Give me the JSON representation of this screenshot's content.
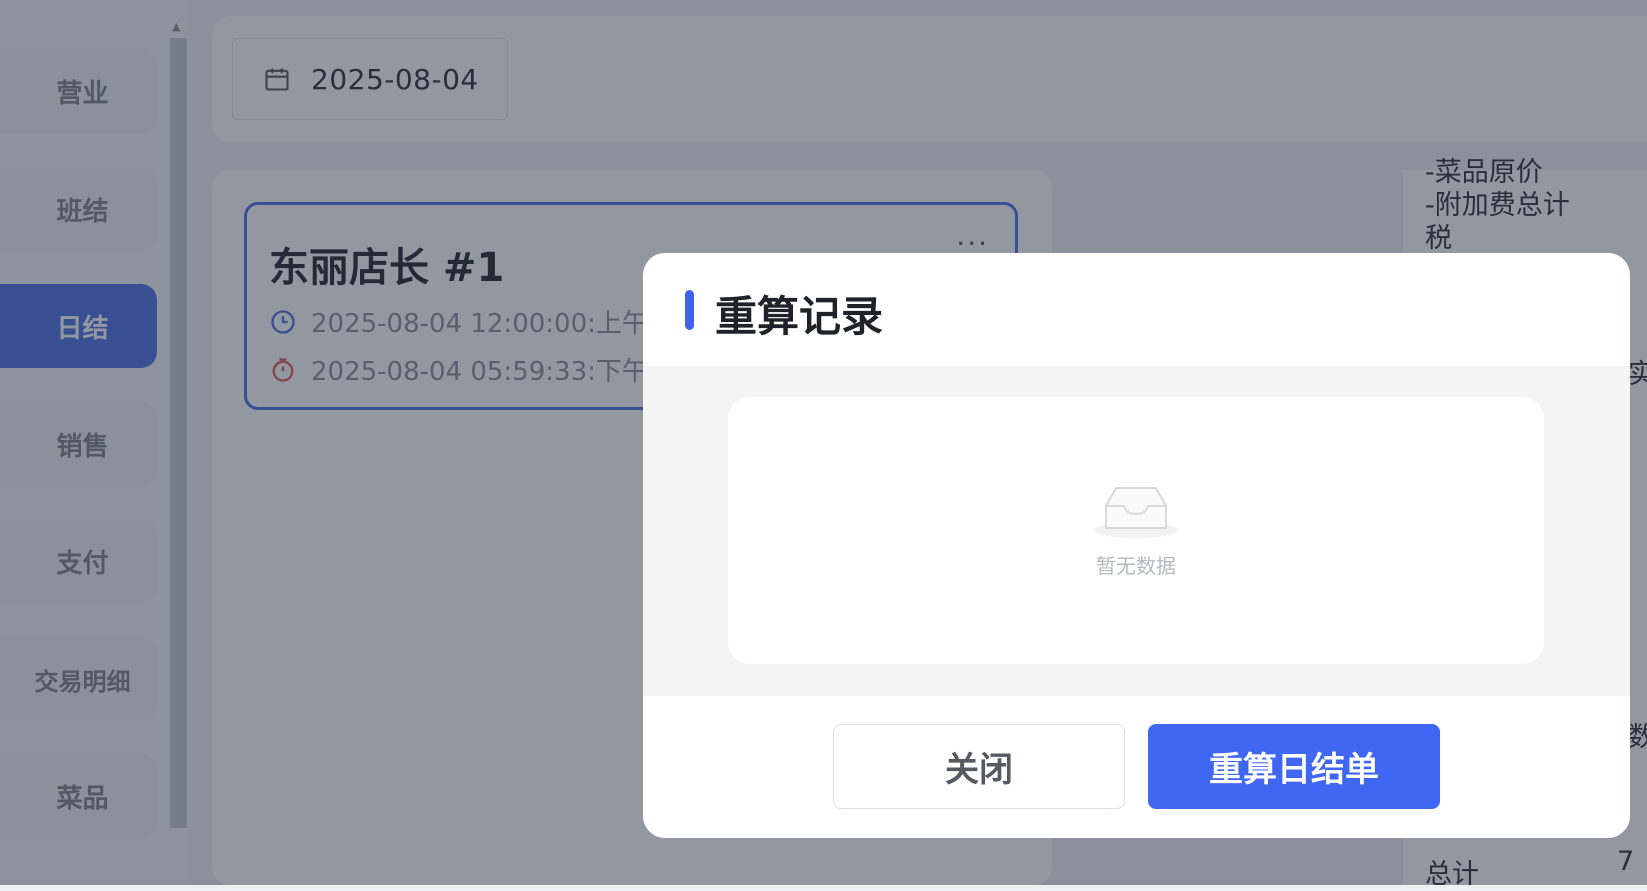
{
  "sidebar": {
    "items": [
      {
        "label": "营业"
      },
      {
        "label": "班结"
      },
      {
        "label": "日结",
        "active": true
      },
      {
        "label": "销售"
      },
      {
        "label": "支付"
      },
      {
        "label": "交易明细"
      },
      {
        "label": "菜品"
      }
    ]
  },
  "toolbar": {
    "date": "2025-08-04"
  },
  "record_card": {
    "title": "东丽店长 #1",
    "start_time": "2025-08-04 12:00:00:上午",
    "end_time": "2025-08-04 05:59:33:下午",
    "more": "···"
  },
  "right_panel": {
    "lines": [
      "-菜品原价",
      "-附加费总计",
      "税",
      "实",
      "数",
      "总计",
      "7"
    ]
  },
  "modal": {
    "title": "重算记录",
    "empty_text": "暂无数据",
    "close_label": "关闭",
    "recalc_label": "重算日结单"
  },
  "colors": {
    "accent": "#3f67f4",
    "nav_active": "#4a6fe4"
  }
}
